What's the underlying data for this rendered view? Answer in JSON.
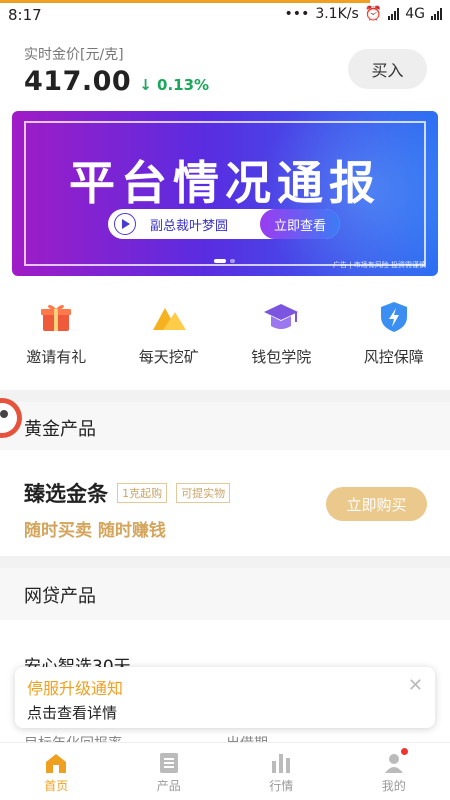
{
  "status_bar": {
    "time": "8:17",
    "net_speed": "3.1K/s",
    "network": "4G"
  },
  "header": {
    "price_label": "实时金价[元/克]",
    "price_value": "417.00",
    "price_change": "0.13%",
    "buy_label": "买入"
  },
  "banner": {
    "title": "平台情况通报",
    "speaker": "副总裁叶梦圆",
    "cta": "立即查看",
    "footnote": "广告 | 市场有风险 投资需谨慎",
    "current_slide": 1,
    "total_slides": 2
  },
  "quick_links": [
    {
      "label": "邀请有礼",
      "icon": "gift-icon"
    },
    {
      "label": "每天挖矿",
      "icon": "mountain-icon"
    },
    {
      "label": "钱包学院",
      "icon": "graduation-cap-icon"
    },
    {
      "label": "风控保障",
      "icon": "shield-icon"
    }
  ],
  "gold_section": {
    "title": "黄金产品",
    "product_name": "臻选金条",
    "tags": [
      "1克起购",
      "可提实物"
    ],
    "slogan": "随时买卖 随时赚钱",
    "buy_label": "立即购买"
  },
  "loan_section": {
    "title": "网贷产品",
    "item_name": "安心智选30天",
    "sub_left": "目标年化回报率",
    "sub_right": "出借期"
  },
  "toast": {
    "title": "停服升级通知",
    "body": "点击查看详情"
  },
  "tabbar": [
    {
      "label": "首页",
      "icon": "home-icon",
      "active": true
    },
    {
      "label": "产品",
      "icon": "product-list-icon",
      "active": false
    },
    {
      "label": "行情",
      "icon": "market-chart-icon",
      "active": false
    },
    {
      "label": "我的",
      "icon": "profile-icon",
      "active": false
    }
  ],
  "colors": {
    "accent": "#f0a020",
    "gold": "#d4a55c",
    "up_down": "#1aa85a"
  }
}
